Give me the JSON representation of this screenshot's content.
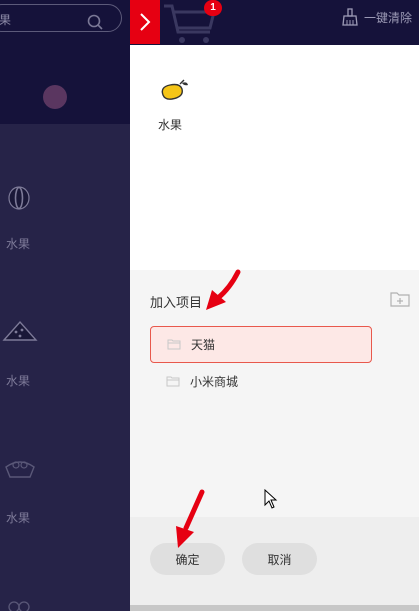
{
  "background_app": {
    "search": {
      "placeholder": "果"
    },
    "categories": [
      {
        "label": "水果",
        "icon": "melon-icon"
      },
      {
        "label": "水果",
        "icon": "watermelon-slice-icon"
      },
      {
        "label": "水果",
        "icon": "basket-icon"
      }
    ]
  },
  "topbar": {
    "expand_icon": "chevron-right-icon",
    "cart_icon": "cart-icon",
    "cart_badge": "1",
    "clear_all_label": "一键清除",
    "clear_icon": "broom-icon"
  },
  "panel": {
    "item": {
      "label": "水果",
      "icon": "mango-icon"
    },
    "section_title": "加入项目",
    "add_folder_icon": "add-folder-icon",
    "projects": [
      {
        "label": "天猫",
        "selected": true
      },
      {
        "label": "小米商城",
        "selected": false
      }
    ],
    "confirm_label": "确定",
    "cancel_label": "取消"
  },
  "colors": {
    "accent_red": "#e60012",
    "selected_bg": "#fde8e6",
    "selected_border": "#e8584c",
    "dark_navy": "#15123a"
  }
}
